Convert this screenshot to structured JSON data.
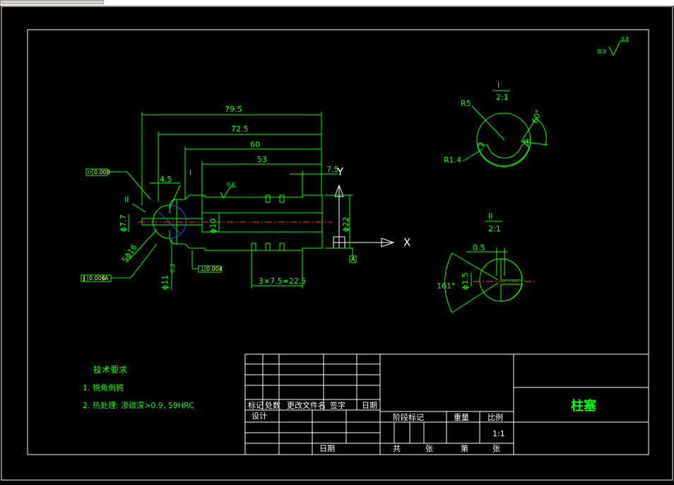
{
  "drawing": {
    "dims": {
      "d79_5": "79.5",
      "d72_5": "72.5",
      "d60": "60",
      "d53": "53",
      "d7_5": "7.5",
      "d4_5": "4.5",
      "dia10": "ϕ10",
      "dia22": "ϕ22",
      "dia7_7": "ϕ7.7",
      "dia11": "ϕ11",
      "dia11_tol": "-0.2",
      "sphere": "Sϕ16",
      "pitch": "3×7.5=22.5",
      "r5": "R5",
      "r1_4": "R1.4",
      "angle60": "60°",
      "w0_5": "0.5",
      "dia1_5": "ϕ1.5",
      "angle161": "161°"
    },
    "axis_x": "X",
    "axis_y": "Y",
    "section_mark_1": "I",
    "section_mark_2": "II",
    "view1_title": "I",
    "view1_scale": "2:1",
    "view2_title": "II",
    "view2_scale": "2:1",
    "roughness_general": "0.8",
    "roughness_general_label": "其余",
    "roughness_part": "0.8",
    "tolerances": {
      "t1_sym": "⌭",
      "t1_val": "0.008",
      "t2_sym": "∥",
      "t2_val": "0.006",
      "t2_ref": "A",
      "t3_sym": "⊥",
      "t3_val": "0.004",
      "datum": "A"
    },
    "tech": {
      "heading": "技术要求",
      "line1": "1. 锐角倒钝",
      "line2": "2. 热处理: 渗碳深>0.9, 59HRC"
    }
  },
  "title_block": {
    "part_name": "柱塞",
    "scale_value": "1:1",
    "rev_headers": [
      "标记",
      "处数",
      "更改文件名",
      "签字",
      "日期"
    ],
    "design": "设计",
    "date": "日期",
    "stage": "阶段标记",
    "weight": "重量",
    "scale_label": "比例",
    "sheet_total": "共",
    "sheet_total_unit": "张",
    "sheet_no": "第",
    "sheet_no_unit": "张"
  }
}
